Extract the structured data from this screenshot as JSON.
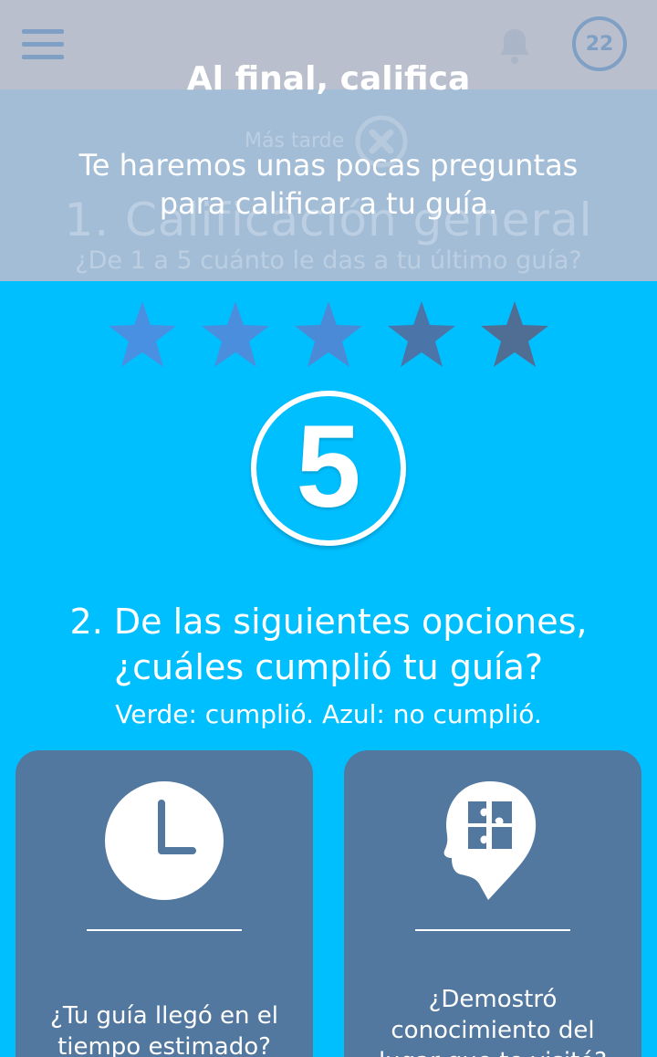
{
  "topbar": {
    "menu_icon": "hamburger-menu-icon",
    "bell_icon": "bell-icon",
    "counter": "22"
  },
  "header": {
    "later_label": "Más tarde",
    "close_icon": "close-icon",
    "section1_title": "1. Calificación general",
    "section1_question": "¿De 1 a 5 cuánto le das a tu último guía?"
  },
  "overlay": {
    "title": "Al final, califica",
    "text": "Te haremos unas pocas preguntas para calificar a tu guía."
  },
  "rating": {
    "max": 5,
    "value": 5,
    "score_display": "5"
  },
  "section2": {
    "title": "2. De las siguientes opciones, ¿cuáles cumplió tu guía?",
    "subtitle": "Verde: cumplió. Azul: no cumplió.",
    "options": [
      {
        "icon": "clock-icon",
        "label": "¿Tu guía llegó en el tiempo estimado?"
      },
      {
        "icon": "head-puzzle-icon",
        "label": "¿Demostró conocimiento del lugar que te visitó?"
      }
    ]
  },
  "colors": {
    "background": "#00bfff",
    "card": "#5378a0",
    "overlay_dim": "#a3bdd6",
    "topbar": "#b9bfcc"
  }
}
